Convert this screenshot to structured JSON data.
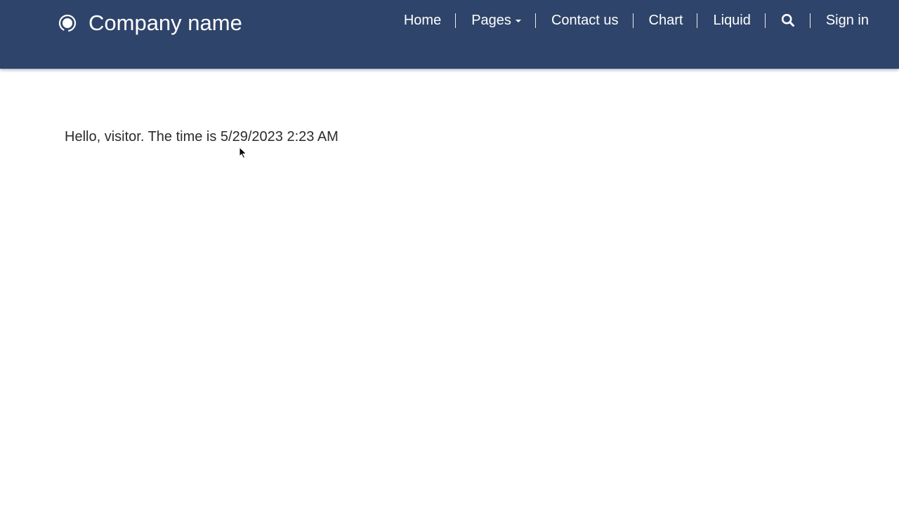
{
  "header": {
    "brand_name": "Company name",
    "logo_icon": "radio-circle-logo-icon",
    "background_color": "#2f446a",
    "nav": {
      "home": "Home",
      "pages": "Pages",
      "contact": "Contact us",
      "chart": "Chart",
      "liquid": "Liquid",
      "search_icon": "search-icon",
      "sign_in": "Sign in"
    }
  },
  "main": {
    "greeting": "Hello, visitor. The time is 5/29/2023 2:23 AM"
  }
}
